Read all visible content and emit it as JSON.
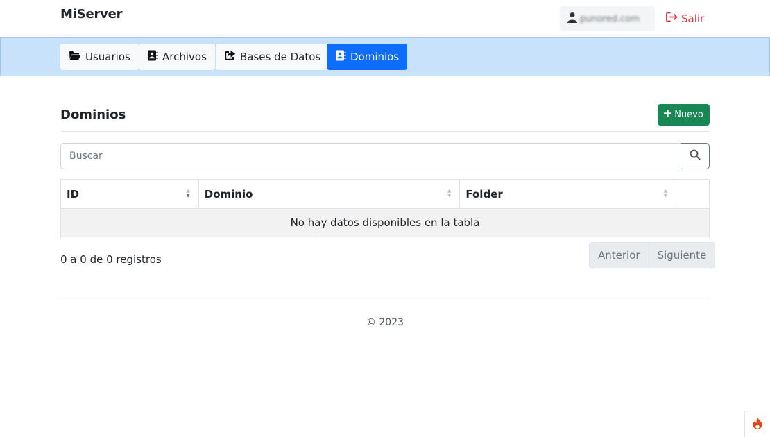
{
  "app": {
    "title": "MiServer"
  },
  "user": {
    "name": "punored.com",
    "logout_label": "Salir"
  },
  "nav": {
    "tabs": [
      {
        "label": "Usuarios",
        "icon": "folder-open-icon"
      },
      {
        "label": "Archivos",
        "icon": "address-book-icon"
      },
      {
        "label": "Bases de Datos",
        "icon": "share-square-icon"
      },
      {
        "label": "Dominios",
        "icon": "address-book-icon",
        "active": true
      }
    ]
  },
  "page": {
    "title": "Dominios",
    "new_button_label": "Nuevo"
  },
  "search": {
    "placeholder": "Buscar"
  },
  "table": {
    "columns": [
      "ID",
      "Dominio",
      "Folder",
      ""
    ],
    "empty_message": "No hay datos disponibles en la tabla"
  },
  "pagination": {
    "info": "0 a 0 de 0 registros",
    "prev_label": "Anterior",
    "next_label": "Siguiente"
  },
  "footer": {
    "text": "© 2023"
  },
  "colors": {
    "primary": "#0d6efd",
    "success": "#198754",
    "danger": "#dc3545",
    "nav_bg": "#c9e2fb"
  }
}
